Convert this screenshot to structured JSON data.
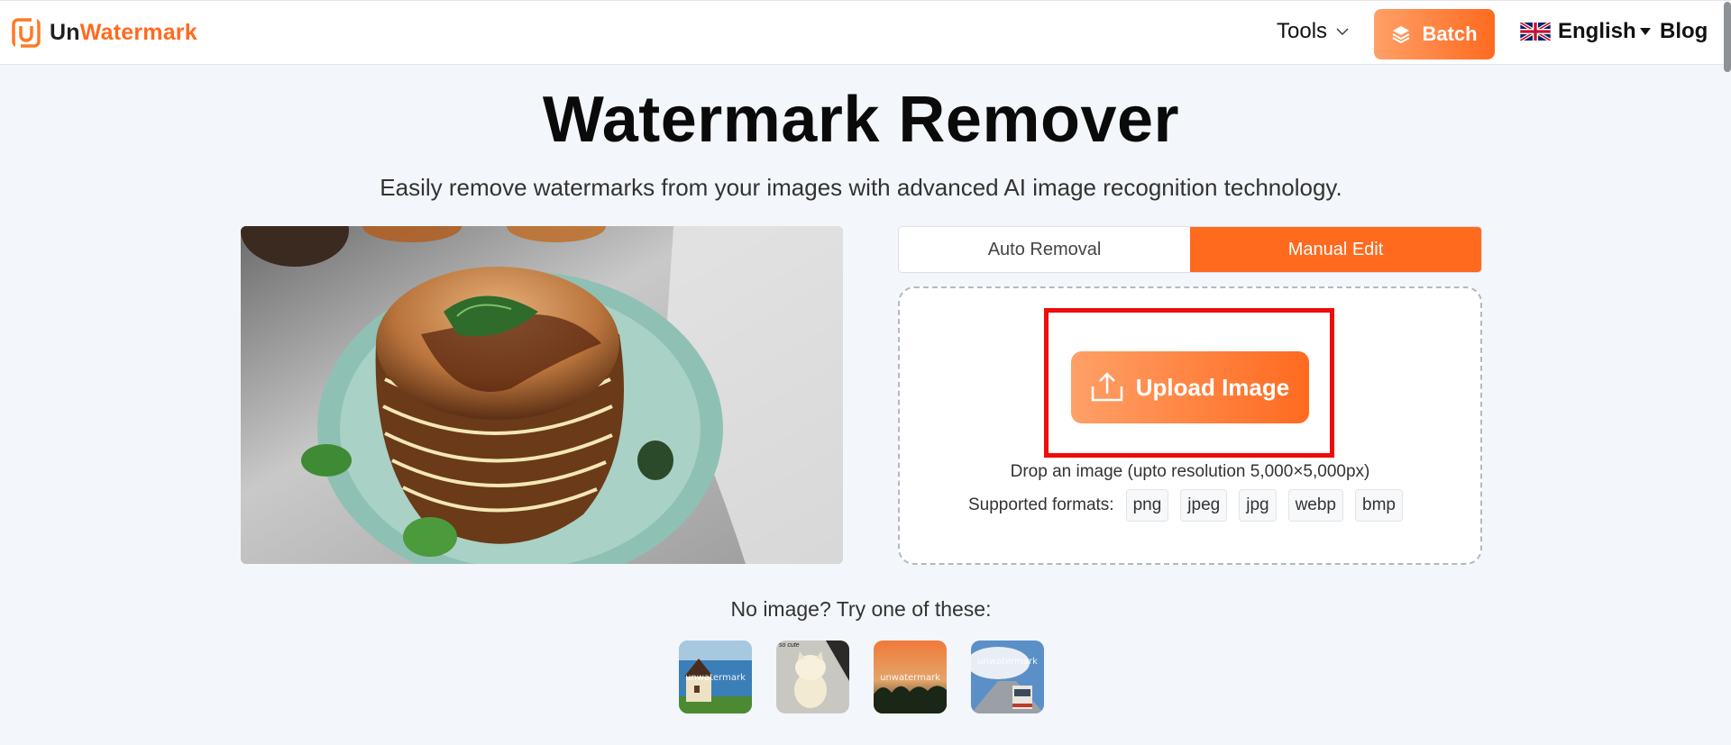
{
  "header": {
    "logo": {
      "part1": "Un",
      "part2": "Watermark",
      "icon": "unwatermark-logo-icon"
    },
    "nav": {
      "tools_label": "Tools",
      "batch_label": "Batch",
      "language_label": "English",
      "blog_label": "Blog"
    }
  },
  "main": {
    "title": "Watermark Remover",
    "subtitle": "Easily remove watermarks from your images with advanced AI image recognition technology.",
    "tabs": [
      {
        "label": "Auto Removal",
        "active": false
      },
      {
        "label": "Manual Edit",
        "active": true
      }
    ],
    "upload": {
      "button_label": "Upload Image",
      "drop_hint": "Drop an image (upto resolution 5,000×5,000px)",
      "formats_label": "Supported formats:",
      "formats": [
        "png",
        "jpeg",
        "jpg",
        "webp",
        "bmp"
      ]
    },
    "samples": {
      "prompt": "No image? Try one of these:",
      "items": [
        {
          "name": "house-by-sea",
          "watermark": "unwatermark"
        },
        {
          "name": "kitten",
          "watermark": "so cute"
        },
        {
          "name": "sunset-trees",
          "watermark": "unwatermark"
        },
        {
          "name": "bus-road-clouds",
          "watermark": "unwatermark"
        }
      ]
    }
  },
  "colors": {
    "accent": "#ff6a1f",
    "accent_light": "#ffa067",
    "highlight_box": "#ee0c0c",
    "background": "#f3f6fa"
  }
}
